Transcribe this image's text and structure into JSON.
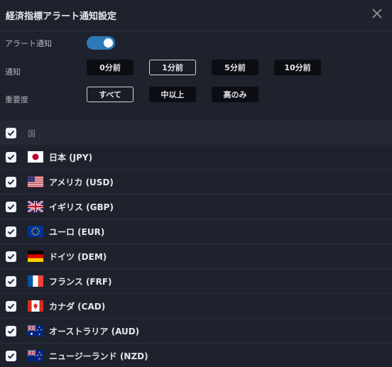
{
  "dialog": {
    "title": "経済指標アラート通知設定"
  },
  "settings": {
    "alert_label": "アラート通知",
    "alert_enabled": true,
    "notify_label": "通知",
    "notify_options": [
      "0分前",
      "1分前",
      "5分前",
      "10分前"
    ],
    "notify_selected": "1分前",
    "importance_label": "重要度",
    "importance_options": [
      "すべて",
      "中以上",
      "高のみ"
    ],
    "importance_selected": "すべて"
  },
  "table": {
    "header_label": "国",
    "header_checked": true,
    "countries": [
      {
        "name": "日本 (JPY)",
        "flag": "japan-flag-icon",
        "checked": true
      },
      {
        "name": "アメリカ (USD)",
        "flag": "usa-flag-icon",
        "checked": true
      },
      {
        "name": "イギリス (GBP)",
        "flag": "uk-flag-icon",
        "checked": true
      },
      {
        "name": "ユーロ (EUR)",
        "flag": "eu-flag-icon",
        "checked": true
      },
      {
        "name": "ドイツ (DEM)",
        "flag": "germany-flag-icon",
        "checked": true
      },
      {
        "name": "フランス (FRF)",
        "flag": "france-flag-icon",
        "checked": true
      },
      {
        "name": "カナダ (CAD)",
        "flag": "canada-flag-icon",
        "checked": true
      },
      {
        "name": "オーストラリア (AUD)",
        "flag": "australia-flag-icon",
        "checked": true
      },
      {
        "name": "ニュージーランド (NZD)",
        "flag": "new-zealand-flag-icon",
        "checked": true
      }
    ]
  },
  "colors": {
    "background": "#1e222d",
    "toggle_on": "#2c7ab5",
    "pill_bg": "#0b0d12",
    "header_row_bg": "#252935"
  }
}
